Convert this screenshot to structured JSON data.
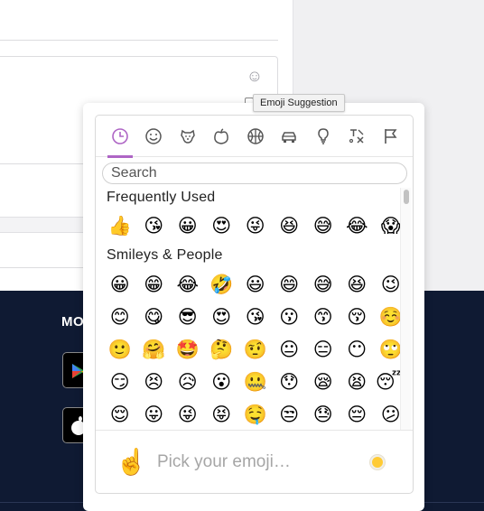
{
  "tooltip": {
    "text": "Emoji Suggestion"
  },
  "footer": {
    "heading_fragment": "MO"
  },
  "picker": {
    "accent_color": "#ae65c5",
    "categories": [
      {
        "icon": "clock-icon",
        "active": true
      },
      {
        "icon": "smiley-icon",
        "active": false
      },
      {
        "icon": "dog-icon",
        "active": false
      },
      {
        "icon": "apple-icon",
        "active": false
      },
      {
        "icon": "basketball-icon",
        "active": false
      },
      {
        "icon": "car-icon",
        "active": false
      },
      {
        "icon": "lightbulb-icon",
        "active": false
      },
      {
        "icon": "symbols-icon",
        "active": false
      },
      {
        "icon": "flag-icon",
        "active": false
      }
    ],
    "search": {
      "placeholder": "Search",
      "value": ""
    },
    "sections": [
      {
        "title": "Frequently Used",
        "rows": [
          [
            "👍",
            "😘",
            "😀",
            "😍",
            "😜",
            "😆",
            "😅",
            "😂",
            "😱"
          ]
        ]
      },
      {
        "title": "Smileys & People",
        "rows": [
          [
            "😀",
            "😁",
            "😂",
            "🤣",
            "😃",
            "😄",
            "😅",
            "😆",
            "😉"
          ],
          [
            "😊",
            "😋",
            "😎",
            "😍",
            "😘",
            "😗",
            "😙",
            "😚",
            "☺️"
          ],
          [
            "🙂",
            "🤗",
            "🤩",
            "🤔",
            "🤨",
            "😐",
            "😑",
            "😶",
            "🙄"
          ],
          [
            "😏",
            "😣",
            "😥",
            "😮",
            "🤐",
            "😯",
            "😪",
            "😫",
            "😴"
          ],
          [
            "😌",
            "😛",
            "😜",
            "😝",
            "🤤",
            "😒",
            "😓",
            "😔",
            "😕"
          ]
        ]
      }
    ],
    "preview": {
      "emoji": "☝️",
      "text": "Pick your emoji…",
      "skin_tone_color": "#ffcb35"
    }
  }
}
